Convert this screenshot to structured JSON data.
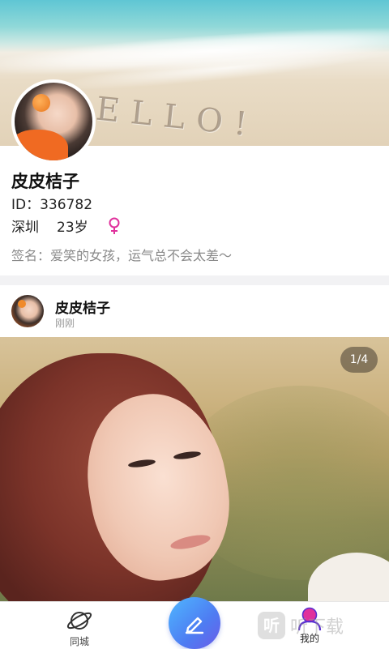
{
  "cover": {
    "sand_text": "ELLO!"
  },
  "profile": {
    "name": "皮皮桔子",
    "id_label": "ID：",
    "id_value": "336782",
    "city": "深圳",
    "age": "23岁",
    "gender": "female",
    "signature": "签名：爱笑的女孩，运气总不会太差～"
  },
  "post": {
    "author": "皮皮桔子",
    "time": "刚刚",
    "photo_counter": "1/4"
  },
  "tabbar": {
    "items": [
      {
        "label": "同城",
        "icon": "planet-icon"
      },
      {
        "label": "",
        "icon": "pen-icon"
      },
      {
        "label": "我的",
        "icon": "person-icon"
      }
    ]
  },
  "watermark": {
    "icon_text": "听",
    "text": "听下载"
  },
  "colors": {
    "accent_pink": "#e0319c",
    "accent_blue": "#4e7cf2"
  }
}
